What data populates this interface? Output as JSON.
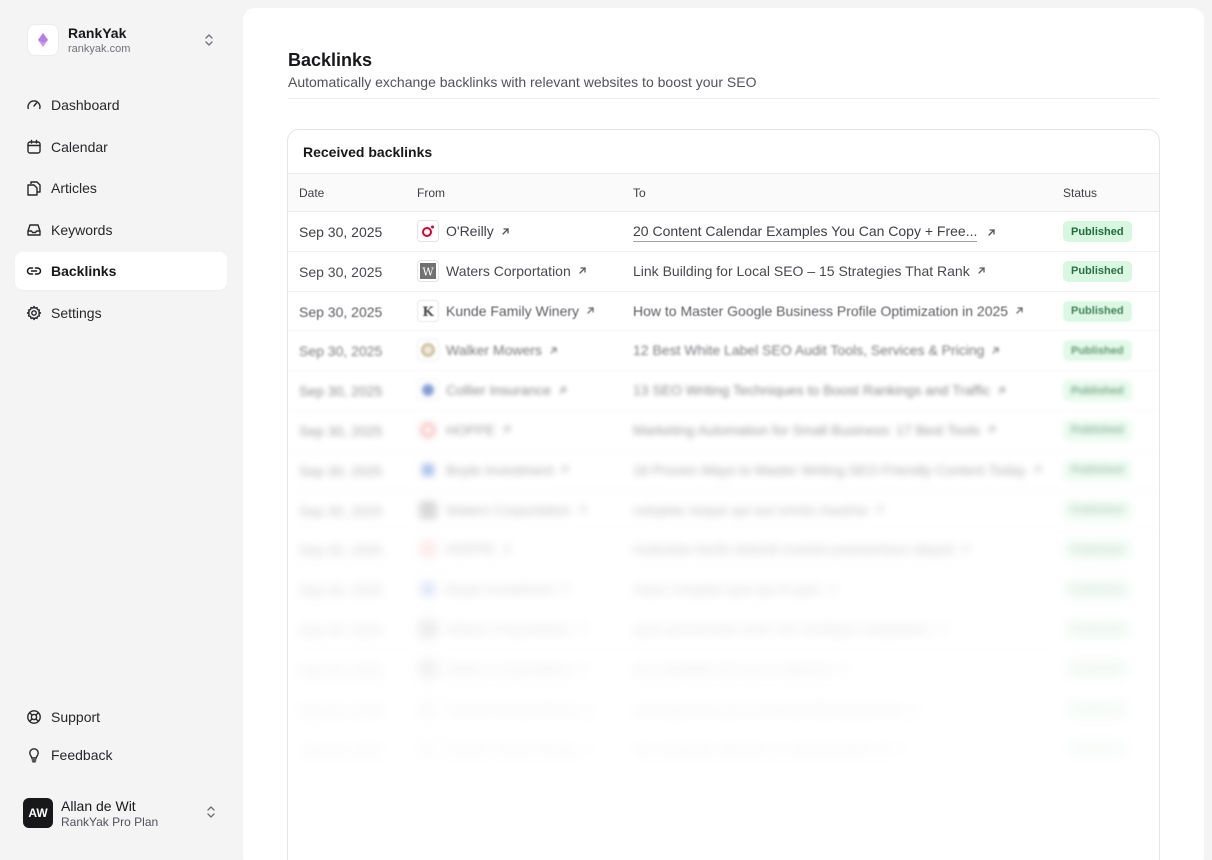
{
  "workspace": {
    "name": "RankYak",
    "domain": "rankyak.com"
  },
  "nav": {
    "items": [
      {
        "label": "Dashboard",
        "icon": "gauge-icon"
      },
      {
        "label": "Calendar",
        "icon": "calendar-icon"
      },
      {
        "label": "Articles",
        "icon": "files-icon"
      },
      {
        "label": "Keywords",
        "icon": "inbox-icon"
      },
      {
        "label": "Backlinks",
        "icon": "link-icon",
        "active": true
      },
      {
        "label": "Settings",
        "icon": "gear-icon"
      }
    ],
    "bottom": [
      {
        "label": "Support",
        "icon": "lifebuoy-icon"
      },
      {
        "label": "Feedback",
        "icon": "lightbulb-icon"
      }
    ]
  },
  "user": {
    "initials": "AW",
    "name": "Allan de Wit",
    "plan": "RankYak Pro Plan"
  },
  "page": {
    "title": "Backlinks",
    "subtitle": "Automatically exchange backlinks with relevant websites to boost your SEO"
  },
  "card": {
    "title": "Received backlinks",
    "columns": {
      "date": "Date",
      "from": "From",
      "to": "To",
      "status": "Status"
    }
  },
  "colors": {
    "accent": "#b57ee5",
    "badge_bg": "#d7f7e0",
    "badge_text": "#216b3a",
    "active_nav_bg": "#ffffff"
  },
  "rows": [
    {
      "date": "Sep 30, 2025",
      "from": "O'Reilly",
      "to": "20 Content Calendar Examples You Can Copy + Free...",
      "status": "Published"
    },
    {
      "date": "Sep 30, 2025",
      "from": "Waters Corportation",
      "to": "Link Building for Local SEO – 15 Strategies That Rank",
      "status": "Published"
    },
    {
      "date": "Sep 30, 2025",
      "from": "Kunde Family Winery",
      "to": "How to Master Google Business Profile Optimization in 2025",
      "status": "Published"
    },
    {
      "date": "Sep 30, 2025",
      "from": "Walker Mowers",
      "to": "12 Best White Label SEO Audit Tools, Services & Pricing",
      "status": "Published"
    },
    {
      "date": "Sep 30, 2025",
      "from": "Collier Insurance",
      "to": "13 SEO Writing Techniques to Boost Rankings and Traffic",
      "status": "Published"
    },
    {
      "date": "Sep 30, 2025",
      "from": "HOPPE",
      "to": "Marketing Automation for Small Business: 17 Best Tools",
      "status": "Published"
    },
    {
      "date": "Sep 30, 2025",
      "from": "Boyle Investment",
      "to": "16 Proven Ways to Master Writing SEO Friendly Content Today",
      "status": "Published"
    },
    {
      "date": "Sep 30, 2025",
      "from": "Waters Corportation",
      "to": "voluptas neque qui aut omnis maxime",
      "status": "Published"
    },
    {
      "date": "Sep 30, 2025",
      "from": "HOPPE",
      "to": "molestias facilis deleniti eveniet praesentium aliquid",
      "status": "Published"
    },
    {
      "date": "Sep 30, 2025",
      "from": "Boyle Investment",
      "to": "natus voluptas quis qui et quis",
      "status": "Published"
    },
    {
      "date": "Sep 30, 2025",
      "from": "Waters Corportation",
      "to": "quas perferendis enim non similique voluptatem",
      "status": "Published"
    },
    {
      "date": "Sep 30, 2025",
      "from": "Waters Corportation",
      "to": "aut voluptate est non in dolorum",
      "status": "Published"
    },
    {
      "date": "Sep 30, 2025",
      "from": "Kunde Family Winery",
      "to": "consequuntur qui et aut doloribus possimus",
      "status": "Published"
    },
    {
      "date": "Sep 30, 2025",
      "from": "Kunde Family Winery",
      "to": "non excepturi aliquam ut reprehenderit sit",
      "status": "Published"
    }
  ]
}
